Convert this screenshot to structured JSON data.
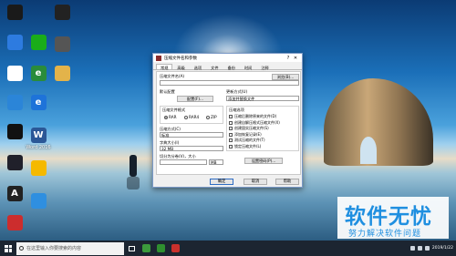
{
  "desktop_icons": [
    {
      "id": "col1-0",
      "label": "",
      "color": "#2d7be0",
      "glyph": ""
    },
    {
      "id": "col1-1",
      "label": "",
      "color": "#ffffff",
      "glyph": ""
    },
    {
      "id": "col1-2",
      "label": "",
      "color": "#2b85d8",
      "glyph": ""
    },
    {
      "id": "col1-3",
      "label": "",
      "color": "#111111",
      "glyph": ""
    },
    {
      "id": "col1-4",
      "label": "",
      "color": "#20202a",
      "glyph": ""
    },
    {
      "id": "col1-5",
      "label": "",
      "color": "#222222",
      "glyph": "A"
    },
    {
      "id": "col1-6",
      "label": "",
      "color": "#cc2d2d",
      "glyph": ""
    },
    {
      "id": "col1-7",
      "label": "",
      "color": "#1a1a1a",
      "glyph": ""
    },
    {
      "id": "col2-0",
      "label": "",
      "color": "#1aad19",
      "glyph": ""
    },
    {
      "id": "col2-1",
      "label": "",
      "color": "#2a8c3a",
      "glyph": "e"
    },
    {
      "id": "col2-2",
      "label": "",
      "color": "#1e73d9",
      "glyph": "e"
    },
    {
      "id": "col2-3",
      "label": "Word 2016",
      "color": "#2b5797",
      "glyph": "W"
    },
    {
      "id": "col2-4",
      "label": "",
      "color": "#f5b900",
      "glyph": ""
    },
    {
      "id": "col2-5",
      "label": "",
      "color": "#2f8fe0",
      "glyph": ""
    },
    {
      "id": "col3-0",
      "label": "",
      "color": "#222222",
      "glyph": ""
    },
    {
      "id": "col3-1",
      "label": "",
      "color": "#555555",
      "glyph": ""
    },
    {
      "id": "col3-2",
      "label": "",
      "color": "#e3b34a",
      "glyph": ""
    }
  ],
  "dialog": {
    "title": "压缩文件名和参数",
    "tabs": [
      "常规",
      "高级",
      "选项",
      "文件",
      "备份",
      "时间",
      "注释"
    ],
    "archive_name_label": "压缩文件名(A)",
    "browse_button": "浏览(B)...",
    "archive_name_value": "",
    "profile_label": "默认配置",
    "profile_button": "配置(F)...",
    "update_mode_label": "更新方式(U)",
    "update_mode_value": "添加并替换文件",
    "format_label": "压缩文件格式",
    "formats": [
      "RAR",
      "RAR4",
      "ZIP"
    ],
    "selected_format": "RAR",
    "method_label": "压缩方式(C)",
    "method_value": "标准",
    "dict_label": "字典大小(I)",
    "dict_value": "32 MB",
    "split_label": "切分为分卷(V)，大小",
    "split_value": "",
    "split_unit": "MB",
    "options_label": "压缩选项",
    "options": [
      "压缩后删除原来的文件(D)",
      "创建自解压格式压缩文件(X)",
      "创建固实压缩文件(S)",
      "添加恢复记录(E)",
      "测试压缩的文件(T)",
      "锁定压缩文件(L)"
    ],
    "password_button": "设置密码(P)...",
    "ok_button": "确定",
    "cancel_button": "取消",
    "help_button": "帮助"
  },
  "watermark": {
    "title": "软件无忧",
    "subtitle": "努力解决软件问题"
  },
  "taskbar": {
    "search_placeholder": "在这里输入你要搜索的内容",
    "pinned": [
      "#3c9a3c",
      "#2f8f2f",
      "#c9302c"
    ],
    "clock_date": "2019/1/22"
  }
}
